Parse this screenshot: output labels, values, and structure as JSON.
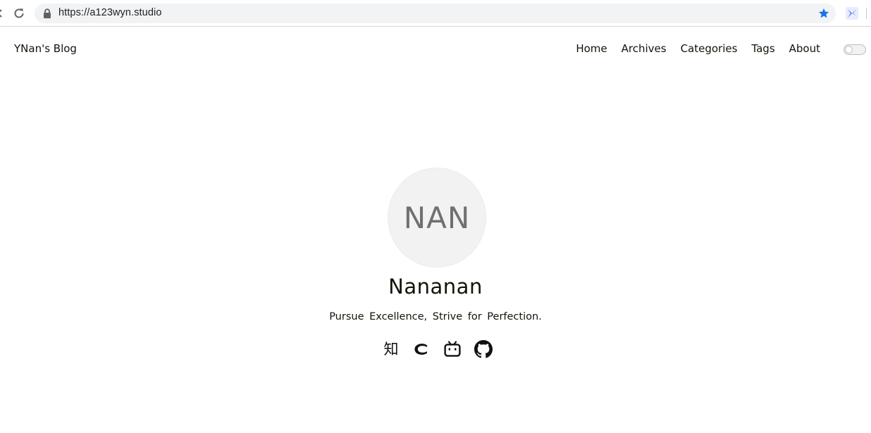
{
  "browser": {
    "url": "https://a123wyn.studio",
    "icons": {
      "reload": "reload-icon",
      "lock": "lock-icon",
      "bookmark": "star-icon",
      "extension": "extension-icon"
    },
    "colors": {
      "star": "#1a73e8",
      "omnibox_bg": "#f1f3f4"
    }
  },
  "site": {
    "brand": "YNan's Blog",
    "nav": [
      {
        "label": "Home"
      },
      {
        "label": "Archives"
      },
      {
        "label": "Categories"
      },
      {
        "label": "Tags"
      },
      {
        "label": "About"
      }
    ],
    "theme_toggle": {
      "state": "off"
    }
  },
  "profile": {
    "avatar_text": "NAN",
    "name": "Nananan",
    "motto": "Pursue Excellence, Strive for Perfection.",
    "socials": [
      {
        "label": "知",
        "icon": "zhihu-icon"
      },
      {
        "icon": "csdn-icon"
      },
      {
        "icon": "bilibili-icon"
      },
      {
        "icon": "github-icon"
      }
    ]
  }
}
